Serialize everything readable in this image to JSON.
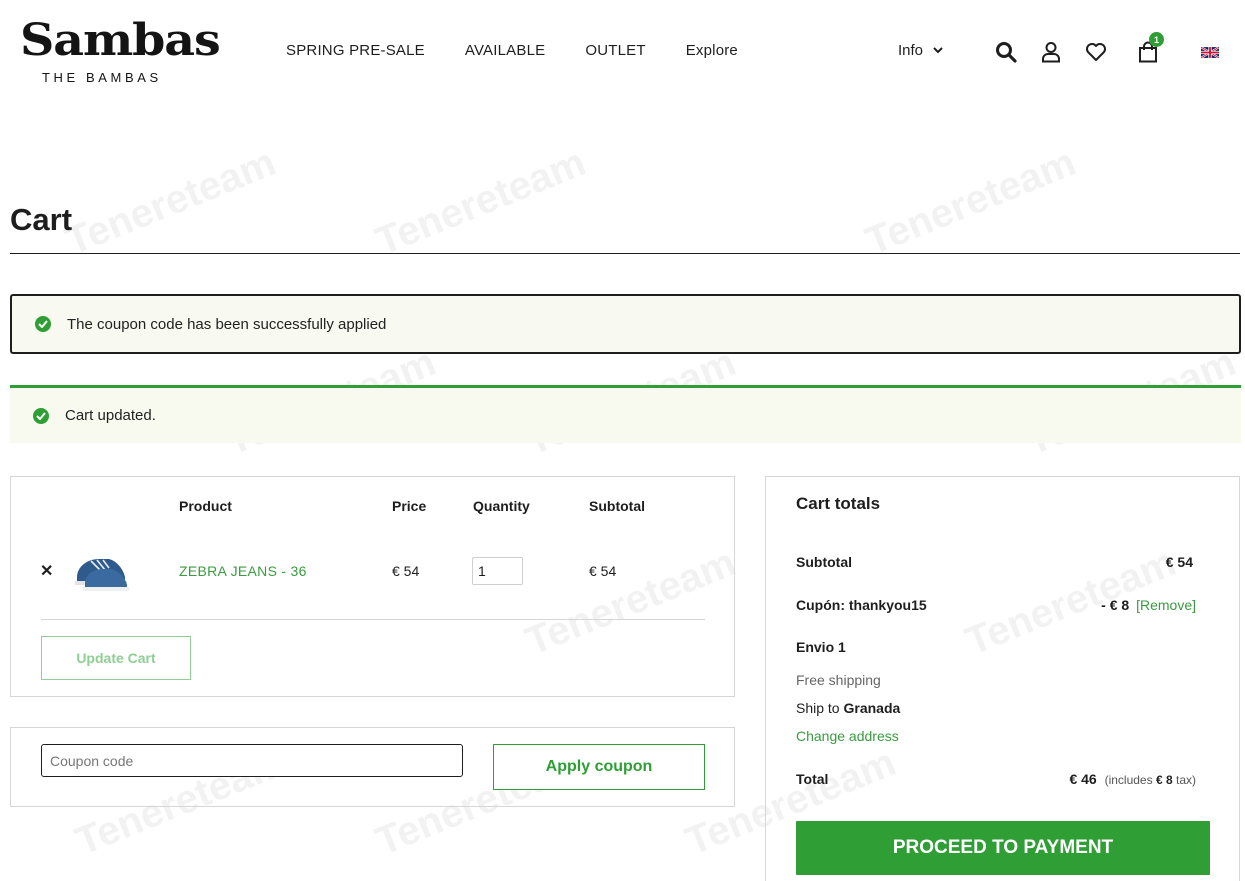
{
  "header": {
    "logo_text": "Sambas",
    "logo_subtitle": "THE BAMBAS",
    "nav": [
      "SPRING PRE-SALE",
      "AVAILABLE",
      "OUTLET",
      "Explore"
    ],
    "info_label": "Info",
    "cart_count": "1",
    "icons": [
      "search-icon",
      "account-icon",
      "heart-icon",
      "cart-icon",
      "uk-flag-icon"
    ]
  },
  "page": {
    "title": "Cart"
  },
  "notices": {
    "coupon_applied": "The coupon code has been successfully applied",
    "cart_updated": "Cart updated."
  },
  "cart_table": {
    "headers": {
      "product": "Product",
      "price": "Price",
      "quantity": "Quantity",
      "subtotal": "Subtotal"
    },
    "rows": [
      {
        "remove": "✕",
        "product": "ZEBRA JEANS - 36",
        "price": "€ 54",
        "quantity": "1",
        "subtotal": "€ 54"
      }
    ],
    "update_label": "Update Cart"
  },
  "coupon": {
    "placeholder": "Coupon code",
    "apply_label": "Apply coupon"
  },
  "totals": {
    "title": "Cart totals",
    "subtotal_label": "Subtotal",
    "subtotal_value": "€ 54",
    "coupon_label": "Cupón: thankyou15",
    "coupon_value": "- € 8",
    "coupon_remove": "[Remove]",
    "shipping_label": "Envio 1",
    "shipping_method": "Free shipping",
    "ship_to_prefix": "Ship to",
    "ship_to_city": "Granada",
    "change_address": "Change address",
    "total_label": "Total",
    "total_value": "€ 46",
    "tax_prefix": "(includes",
    "tax_value": "€ 8",
    "tax_suffix": "tax)",
    "proceed_label": "PROCEED TO PAYMENT"
  },
  "watermark": "Tenereteam",
  "colors": {
    "brand_green": "#2e9e35",
    "link_green": "#3a9b40",
    "notice_bg": "#f8f9f0"
  }
}
